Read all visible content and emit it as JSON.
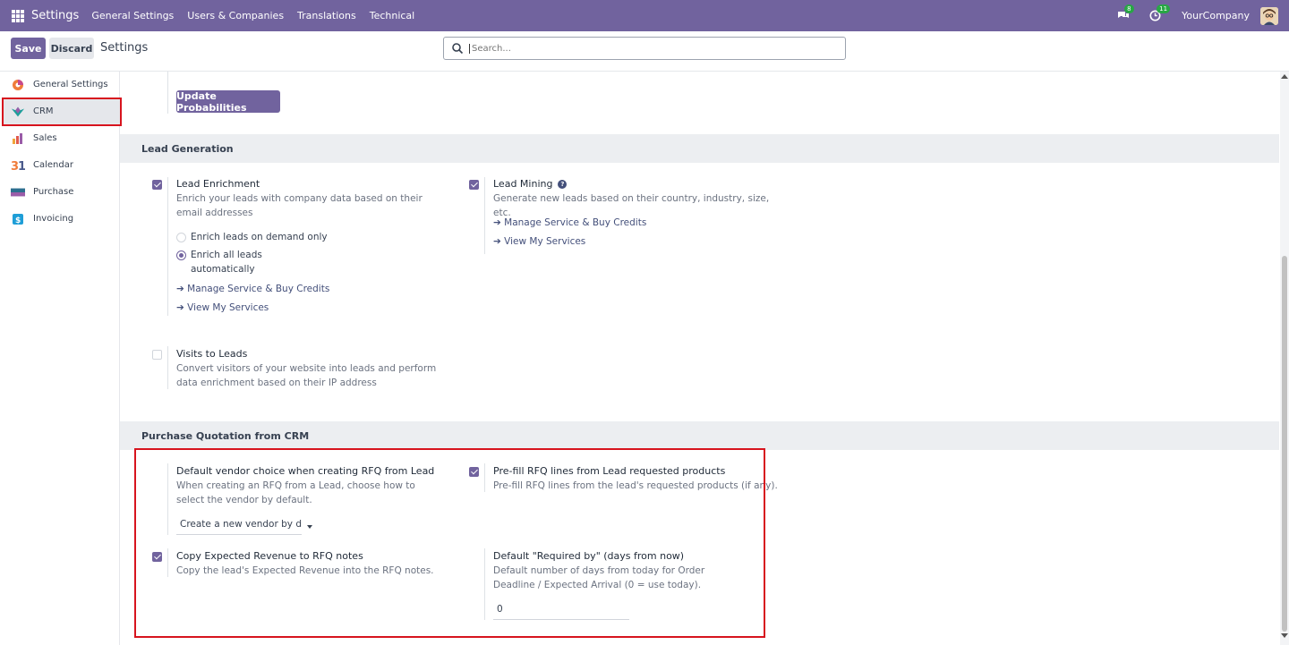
{
  "navbar": {
    "brand": "Settings",
    "menu": [
      "General Settings",
      "Users & Companies",
      "Translations",
      "Technical"
    ],
    "messages_badge": "8",
    "activities_badge": "11",
    "company": "YourCompany"
  },
  "control": {
    "save_label": "Save",
    "discard_label": "Discard",
    "title": "Settings",
    "search_placeholder": "Search..."
  },
  "sidebar": {
    "items": [
      {
        "label": "General Settings",
        "icon": "general-settings-icon"
      },
      {
        "label": "CRM",
        "icon": "crm-icon"
      },
      {
        "label": "Sales",
        "icon": "sales-icon"
      },
      {
        "label": "Calendar",
        "icon": "calendar-icon"
      },
      {
        "label": "Purchase",
        "icon": "purchase-icon"
      },
      {
        "label": "Invoicing",
        "icon": "invoicing-icon"
      }
    ],
    "active": "CRM"
  },
  "top_partial": {
    "update_button": "Update Probabilities"
  },
  "lead_generation": {
    "heading": "Lead Generation",
    "lead_enrichment": {
      "title": "Lead Enrichment",
      "desc": "Enrich your leads with company data based on their email addresses",
      "enabled": true,
      "option_demand": "Enrich leads on demand only",
      "option_auto": "Enrich all leads automatically",
      "selected": "Enrich all leads automatically",
      "link_manage": "Manage Service & Buy Credits",
      "link_view": "View My Services"
    },
    "lead_mining": {
      "title": "Lead Mining",
      "desc": "Generate new leads based on their country, industry, size, etc.",
      "enabled": true,
      "link_manage": "Manage Service & Buy Credits",
      "link_view": "View My Services"
    },
    "visits_to_leads": {
      "title": "Visits to Leads",
      "desc": "Convert visitors of your website into leads and perform data enrichment based on their IP address",
      "enabled": false
    }
  },
  "purchase_quotation": {
    "heading": "Purchase Quotation from CRM",
    "default_vendor": {
      "title": "Default vendor choice when creating RFQ from Lead",
      "desc": "When creating an RFQ from a Lead, choose how to select the vendor by default.",
      "value": "Create a new vendor by default"
    },
    "prefill": {
      "title": "Pre-fill RFQ lines from Lead requested products",
      "desc": "Pre-fill RFQ lines from the lead's requested products (if any).",
      "enabled": true
    },
    "copy_revenue": {
      "title": "Copy Expected Revenue to RFQ notes",
      "desc": "Copy the lead's Expected Revenue into the RFQ notes.",
      "enabled": true
    },
    "required_by": {
      "title": "Default \"Required by\" (days from now)",
      "desc": "Default number of days from today for Order Deadline / Expected Arrival (0 = use today).",
      "value": "0"
    }
  },
  "colors": {
    "brand": "#71639e",
    "highlight": "#d7141e",
    "link": "#434f7a"
  }
}
